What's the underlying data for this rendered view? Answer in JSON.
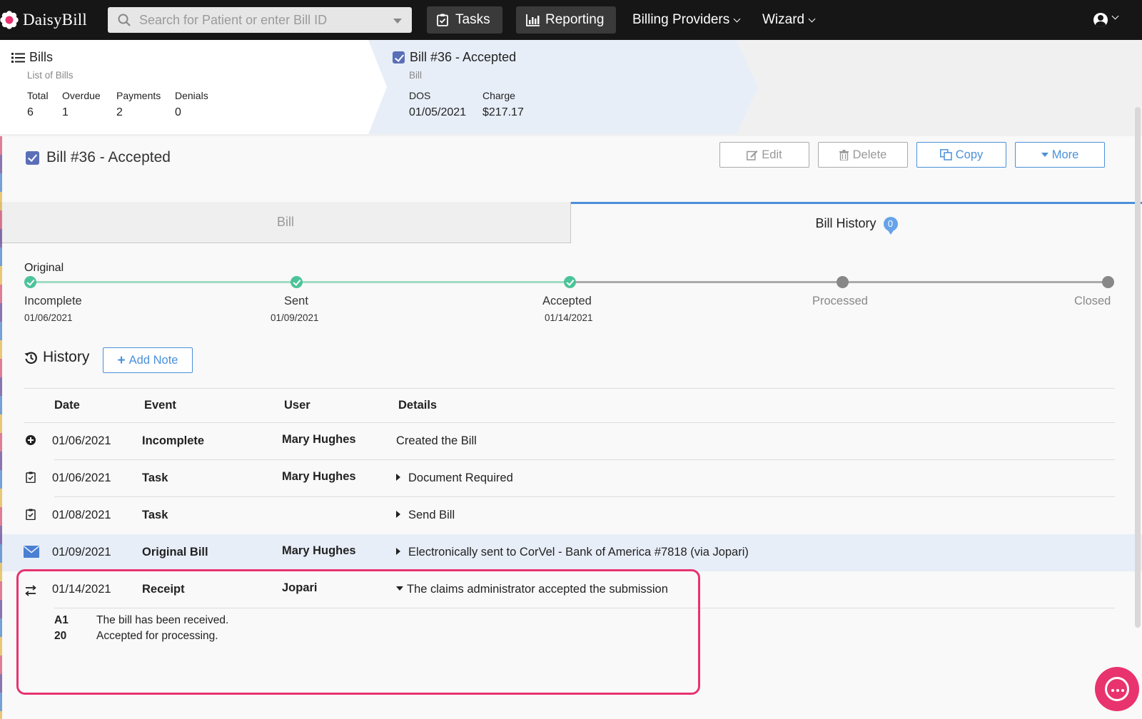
{
  "app": {
    "name": "DaisyBill",
    "search_placeholder": "Search for Patient or enter Bill ID",
    "nav": {
      "tasks": "Tasks",
      "reporting": "Reporting",
      "billing_providers": "Billing Providers",
      "wizard": "Wizard"
    }
  },
  "breadcrumb": {
    "bills": {
      "title": "Bills",
      "subtitle": "List of Bills",
      "stats": [
        {
          "label": "Total",
          "value": "6"
        },
        {
          "label": "Overdue",
          "value": "1"
        },
        {
          "label": "Payments",
          "value": "2"
        },
        {
          "label": "Denials",
          "value": "0"
        }
      ]
    },
    "bill": {
      "title": "Bill #36 - Accepted",
      "subtitle": "Bill",
      "dos_label": "DOS",
      "dos_value": "01/05/2021",
      "charge_label": "Charge",
      "charge_value": "$217.17"
    }
  },
  "page": {
    "title": "Bill #36 - Accepted",
    "actions": {
      "edit": "Edit",
      "delete": "Delete",
      "copy": "Copy",
      "more": "More"
    },
    "tabs": {
      "bill": "Bill",
      "history": "Bill History",
      "history_badge": "0"
    }
  },
  "progress": {
    "title": "Original",
    "steps": [
      {
        "label": "Incomplete",
        "date": "01/06/2021",
        "status": "done"
      },
      {
        "label": "Sent",
        "date": "01/09/2021",
        "status": "done"
      },
      {
        "label": "Accepted",
        "date": "01/14/2021",
        "status": "done"
      },
      {
        "label": "Processed",
        "date": "",
        "status": "pending"
      },
      {
        "label": "Closed",
        "date": "",
        "status": "pending"
      }
    ]
  },
  "history": {
    "title": "History",
    "add_note": "Add Note",
    "columns": {
      "date": "Date",
      "event": "Event",
      "user": "User",
      "details": "Details"
    },
    "rows": [
      {
        "icon": "plus-circle-icon",
        "date": "01/06/2021",
        "event": "Incomplete",
        "user": "Mary Hughes",
        "details": "Created the Bill"
      },
      {
        "icon": "clipboard-check-icon",
        "date": "01/06/2021",
        "event": "Task",
        "user": "Mary Hughes",
        "details": "Document Required"
      },
      {
        "icon": "clipboard-check-icon",
        "date": "01/08/2021",
        "event": "Task",
        "user": "",
        "details": "Send Bill"
      },
      {
        "icon": "envelope-icon",
        "date": "01/09/2021",
        "event": "Original Bill",
        "user": "Mary Hughes",
        "details": "Electronically sent to CorVel - Bank of America #7818 (via Jopari)"
      },
      {
        "icon": "exchange-icon",
        "date": "01/14/2021",
        "event": "Receipt",
        "user": "Jopari",
        "details": "The claims administrator accepted the submission"
      }
    ],
    "receipt_details": [
      {
        "code": "A1",
        "text": "The bill has been received."
      },
      {
        "code": "20",
        "text": "Accepted for processing."
      }
    ]
  },
  "colors": {
    "accent": "#4a90d9",
    "success": "#4cc39a",
    "highlight": "#e8336f",
    "nav_bg": "#161616"
  }
}
